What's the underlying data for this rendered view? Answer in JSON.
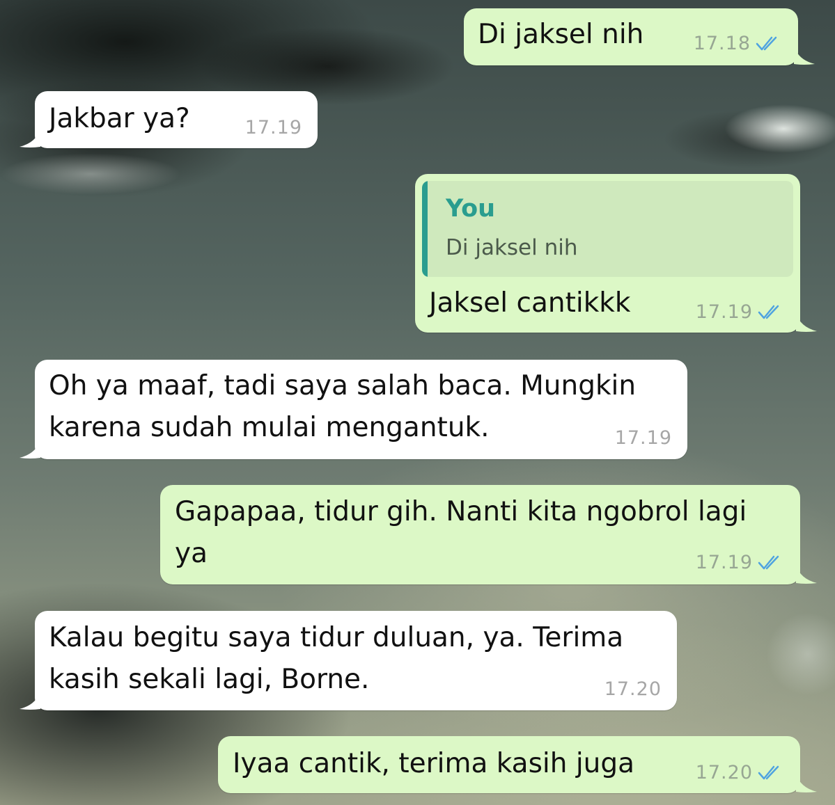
{
  "chat": {
    "messages": [
      {
        "direction": "outgoing",
        "text": "Di jaksel nih",
        "time": "17.18",
        "status_icon": "double-check-icon"
      },
      {
        "direction": "incoming",
        "text": "Jakbar ya?",
        "time": "17.19"
      },
      {
        "direction": "outgoing",
        "quote": {
          "author": "You",
          "text": "Di jaksel nih"
        },
        "text": "Jaksel cantikkk",
        "time": "17.19",
        "status_icon": "double-check-icon"
      },
      {
        "direction": "incoming",
        "lines": [
          "Oh ya maaf, tadi saya salah baca. Mungkin",
          "karena sudah mulai mengantuk."
        ],
        "time": "17.19"
      },
      {
        "direction": "outgoing",
        "lines": [
          "Gapapaa, tidur gih. Nanti kita ngobrol lagi",
          "ya"
        ],
        "time": "17.19",
        "status_icon": "double-check-icon"
      },
      {
        "direction": "incoming",
        "lines": [
          "Kalau begitu saya tidur duluan, ya. Terima",
          "kasih sekali lagi, Borne."
        ],
        "time": "17.20"
      },
      {
        "direction": "outgoing",
        "text": "Iyaa cantik, terima kasih juga",
        "time": "17.20",
        "status_icon": "double-check-icon"
      }
    ]
  },
  "colors": {
    "incoming_bubble": "#ffffff",
    "outgoing_bubble": "#dcf8c6",
    "quote_background": "#cfe9bd",
    "quote_accent": "#2a9d8f",
    "read_ticks": "#4fa3e0",
    "timestamp": "#a6a6a6"
  }
}
